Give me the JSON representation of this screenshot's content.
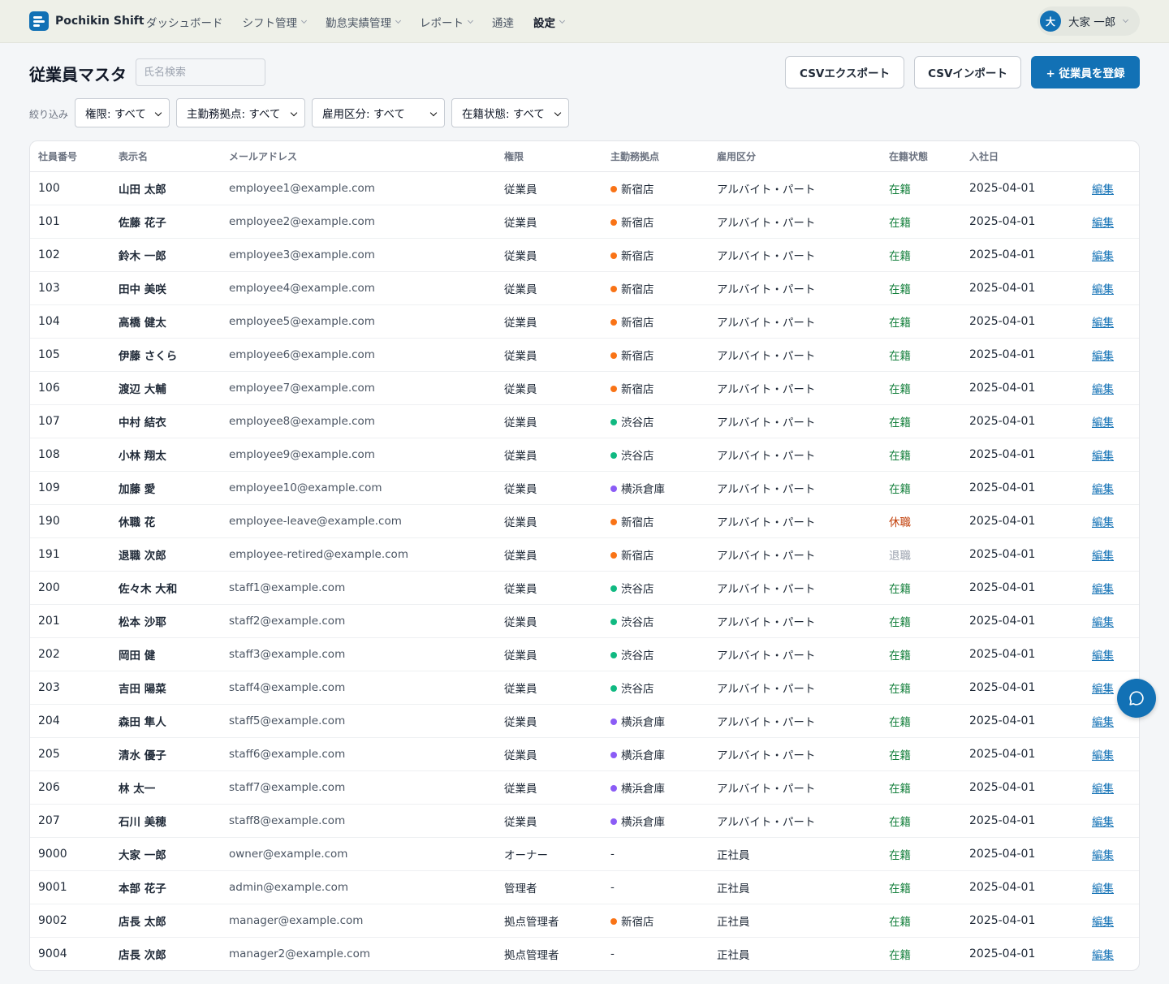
{
  "app": {
    "name": "Pochikin Shift"
  },
  "nav": {
    "items": [
      {
        "label": "ダッシュボード",
        "dropdown": false,
        "active": false
      },
      {
        "label": "シフト管理",
        "dropdown": true,
        "active": false
      },
      {
        "label": "勤怠実績管理",
        "dropdown": true,
        "active": false
      },
      {
        "label": "レポート",
        "dropdown": true,
        "active": false
      },
      {
        "label": "通達",
        "dropdown": false,
        "active": false
      },
      {
        "label": "設定",
        "dropdown": true,
        "active": true
      }
    ]
  },
  "user": {
    "avatar_initial": "大",
    "name": "大家 一郎"
  },
  "page": {
    "title": "従業員マスタ"
  },
  "search": {
    "placeholder": "氏名検索",
    "value": ""
  },
  "actions": {
    "export_label": "CSVエクスポート",
    "import_label": "CSVインポート",
    "register_label": "+ 従業員を登録"
  },
  "filters": {
    "label": "絞り込み",
    "role": "権限: すべて",
    "location": "主勤務拠点: すべて",
    "employment": "雇用区分: すべて",
    "status": "在籍状態: すべて"
  },
  "table": {
    "headers": [
      "社員番号",
      "表示名",
      "メールアドレス",
      "権限",
      "主勤務拠点",
      "雇用区分",
      "在籍状態",
      "入社日",
      ""
    ],
    "edit_label": "編集",
    "rows": [
      {
        "id": "100",
        "name": "山田 太郎",
        "email": "employee1@example.com",
        "role": "従業員",
        "location": "新宿店",
        "employment": "アルバイト・パート",
        "status": "在籍",
        "hired": "2025-04-01"
      },
      {
        "id": "101",
        "name": "佐藤 花子",
        "email": "employee2@example.com",
        "role": "従業員",
        "location": "新宿店",
        "employment": "アルバイト・パート",
        "status": "在籍",
        "hired": "2025-04-01"
      },
      {
        "id": "102",
        "name": "鈴木 一郎",
        "email": "employee3@example.com",
        "role": "従業員",
        "location": "新宿店",
        "employment": "アルバイト・パート",
        "status": "在籍",
        "hired": "2025-04-01"
      },
      {
        "id": "103",
        "name": "田中 美咲",
        "email": "employee4@example.com",
        "role": "従業員",
        "location": "新宿店",
        "employment": "アルバイト・パート",
        "status": "在籍",
        "hired": "2025-04-01"
      },
      {
        "id": "104",
        "name": "高橋 健太",
        "email": "employee5@example.com",
        "role": "従業員",
        "location": "新宿店",
        "employment": "アルバイト・パート",
        "status": "在籍",
        "hired": "2025-04-01"
      },
      {
        "id": "105",
        "name": "伊藤 さくら",
        "email": "employee6@example.com",
        "role": "従業員",
        "location": "新宿店",
        "employment": "アルバイト・パート",
        "status": "在籍",
        "hired": "2025-04-01"
      },
      {
        "id": "106",
        "name": "渡辺 大輔",
        "email": "employee7@example.com",
        "role": "従業員",
        "location": "新宿店",
        "employment": "アルバイト・パート",
        "status": "在籍",
        "hired": "2025-04-01"
      },
      {
        "id": "107",
        "name": "中村 結衣",
        "email": "employee8@example.com",
        "role": "従業員",
        "location": "渋谷店",
        "employment": "アルバイト・パート",
        "status": "在籍",
        "hired": "2025-04-01"
      },
      {
        "id": "108",
        "name": "小林 翔太",
        "email": "employee9@example.com",
        "role": "従業員",
        "location": "渋谷店",
        "employment": "アルバイト・パート",
        "status": "在籍",
        "hired": "2025-04-01"
      },
      {
        "id": "109",
        "name": "加藤 愛",
        "email": "employee10@example.com",
        "role": "従業員",
        "location": "横浜倉庫",
        "employment": "アルバイト・パート",
        "status": "在籍",
        "hired": "2025-04-01"
      },
      {
        "id": "190",
        "name": "休職 花",
        "email": "employee-leave@example.com",
        "role": "従業員",
        "location": "新宿店",
        "employment": "アルバイト・パート",
        "status": "休職",
        "hired": "2025-04-01"
      },
      {
        "id": "191",
        "name": "退職 次郎",
        "email": "employee-retired@example.com",
        "role": "従業員",
        "location": "新宿店",
        "employment": "アルバイト・パート",
        "status": "退職",
        "hired": "2025-04-01"
      },
      {
        "id": "200",
        "name": "佐々木 大和",
        "email": "staff1@example.com",
        "role": "従業員",
        "location": "渋谷店",
        "employment": "アルバイト・パート",
        "status": "在籍",
        "hired": "2025-04-01"
      },
      {
        "id": "201",
        "name": "松本 沙耶",
        "email": "staff2@example.com",
        "role": "従業員",
        "location": "渋谷店",
        "employment": "アルバイト・パート",
        "status": "在籍",
        "hired": "2025-04-01"
      },
      {
        "id": "202",
        "name": "岡田 健",
        "email": "staff3@example.com",
        "role": "従業員",
        "location": "渋谷店",
        "employment": "アルバイト・パート",
        "status": "在籍",
        "hired": "2025-04-01"
      },
      {
        "id": "203",
        "name": "吉田 陽菜",
        "email": "staff4@example.com",
        "role": "従業員",
        "location": "渋谷店",
        "employment": "アルバイト・パート",
        "status": "在籍",
        "hired": "2025-04-01"
      },
      {
        "id": "204",
        "name": "森田 隼人",
        "email": "staff5@example.com",
        "role": "従業員",
        "location": "横浜倉庫",
        "employment": "アルバイト・パート",
        "status": "在籍",
        "hired": "2025-04-01"
      },
      {
        "id": "205",
        "name": "清水 優子",
        "email": "staff6@example.com",
        "role": "従業員",
        "location": "横浜倉庫",
        "employment": "アルバイト・パート",
        "status": "在籍",
        "hired": "2025-04-01"
      },
      {
        "id": "206",
        "name": "林 太一",
        "email": "staff7@example.com",
        "role": "従業員",
        "location": "横浜倉庫",
        "employment": "アルバイト・パート",
        "status": "在籍",
        "hired": "2025-04-01"
      },
      {
        "id": "207",
        "name": "石川 美穂",
        "email": "staff8@example.com",
        "role": "従業員",
        "location": "横浜倉庫",
        "employment": "アルバイト・パート",
        "status": "在籍",
        "hired": "2025-04-01"
      },
      {
        "id": "9000",
        "name": "大家 一郎",
        "email": "owner@example.com",
        "role": "オーナー",
        "location": "-",
        "employment": "正社員",
        "status": "在籍",
        "hired": "2025-04-01"
      },
      {
        "id": "9001",
        "name": "本部 花子",
        "email": "admin@example.com",
        "role": "管理者",
        "location": "-",
        "employment": "正社員",
        "status": "在籍",
        "hired": "2025-04-01"
      },
      {
        "id": "9002",
        "name": "店長 太郎",
        "email": "manager@example.com",
        "role": "拠点管理者",
        "location": "新宿店",
        "employment": "正社員",
        "status": "在籍",
        "hired": "2025-04-01"
      },
      {
        "id": "9004",
        "name": "店長 次郎",
        "email": "manager2@example.com",
        "role": "拠点管理者",
        "location": "-",
        "employment": "正社員",
        "status": "在籍",
        "hired": "2025-04-01"
      }
    ]
  },
  "colors": {
    "brand": "#1271b5",
    "location_dots": {
      "新宿店": "#f97316",
      "渋谷店": "#10b981",
      "横浜倉庫": "#8b5cf6"
    },
    "status": {
      "在籍": "#15803d",
      "休職": "#c2410c",
      "退職": "#9ca3af"
    }
  },
  "chat": {
    "icon": "chat-bubble-icon"
  }
}
